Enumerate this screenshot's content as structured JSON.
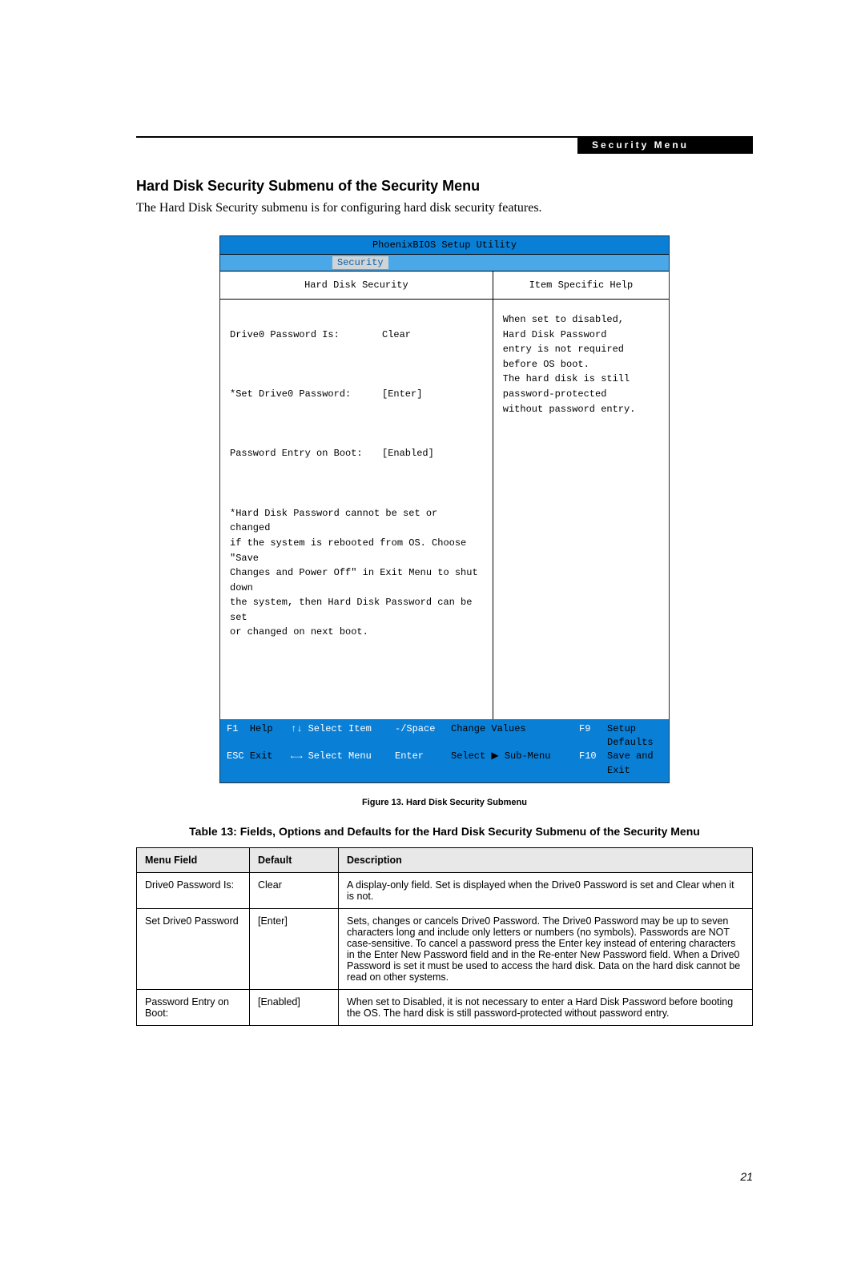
{
  "header": {
    "label": "Security Menu"
  },
  "section": {
    "title": "Hard Disk Security Submenu of the Security Menu",
    "intro": "The Hard Disk Security submenu is for configuring hard disk security features."
  },
  "bios": {
    "title": "PhoenixBIOS Setup Utility",
    "tab": "Security",
    "left_heading": "Hard Disk Security",
    "right_heading": "Item Specific Help",
    "rows": [
      {
        "label": "Drive0 Password Is:",
        "value": "Clear"
      },
      {
        "label": "*Set Drive0 Password:",
        "value": "[Enter]"
      },
      {
        "label": "Password Entry on Boot:",
        "value": "[Enabled]"
      }
    ],
    "note": "*Hard Disk Password cannot be set or changed\nif the system is rebooted from OS. Choose \"Save\nChanges and Power Off\" in Exit Menu to shut down\nthe system, then Hard Disk Password can be set\nor changed on next boot.",
    "help_text": "When set to disabled,\nHard Disk Password\nentry is not required\nbefore OS boot.\nThe hard disk is still\npassword-protected\nwithout password entry.",
    "footer": {
      "line1": {
        "k1": "F1",
        "t1": "Help",
        "arrows1": "↑↓ Select Item",
        "k2": "-/Space",
        "t2": "Change Values",
        "k3": "F9",
        "t3": "Setup Defaults"
      },
      "line2": {
        "k1": "ESC",
        "t1": "Exit",
        "arrows1": "←→ Select Menu",
        "k2": "Enter",
        "t2": "Select ▶ Sub-Menu",
        "k3": "F10",
        "t3": "Save and Exit"
      }
    }
  },
  "figure_caption": "Figure 13.   Hard Disk Security Submenu",
  "table": {
    "title": "Table 13: Fields, Options and Defaults for the Hard Disk Security Submenu of the Security Menu",
    "headers": {
      "menu": "Menu Field",
      "def": "Default",
      "desc": "Description"
    },
    "rows": [
      {
        "menu": "Drive0 Password Is:",
        "def": "Clear",
        "desc": "A display-only field. Set is displayed when the Drive0 Password is set and Clear when it is not."
      },
      {
        "menu": "Set Drive0 Password",
        "def": "[Enter]",
        "desc": "Sets, changes or cancels Drive0 Password. The Drive0 Password may be up to seven characters long and include only letters or numbers (no symbols). Passwords are NOT case-sensitive. To cancel a password press the Enter key instead of entering characters in the Enter New Password field and in the Re-enter New Password field. When a Drive0 Password is set it must be used to access the hard disk. Data on the hard disk cannot be read on other systems."
      },
      {
        "menu": "Password Entry on Boot:",
        "def": "[Enabled]",
        "desc": "When set to Disabled, it is not necessary to enter a Hard Disk Password before booting the OS. The hard disk is still password-protected without password entry."
      }
    ]
  },
  "page_number": "21"
}
